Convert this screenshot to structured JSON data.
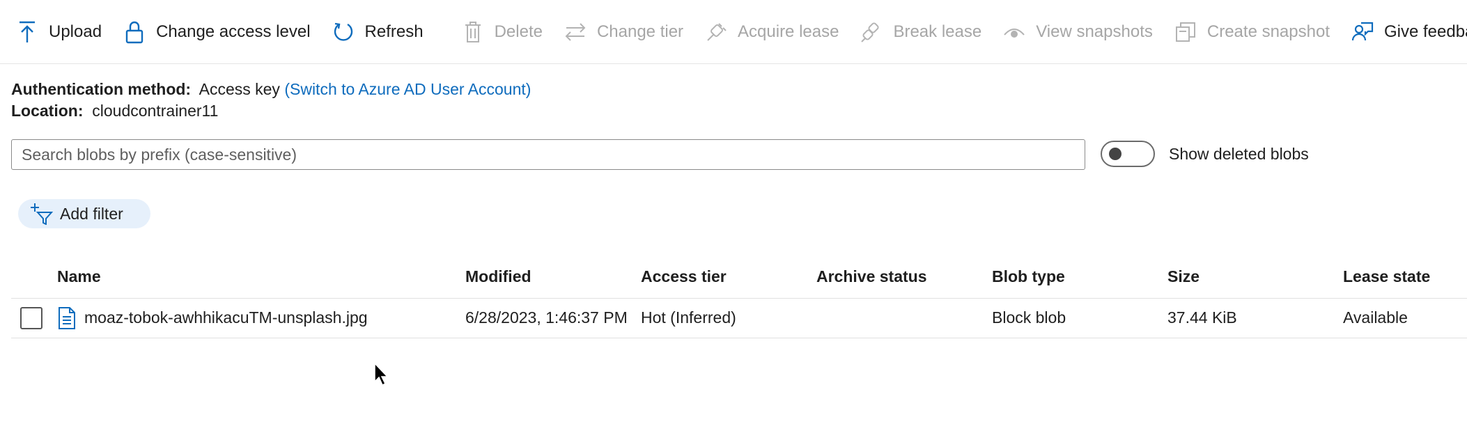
{
  "toolbar": {
    "upload": "Upload",
    "change_access_level": "Change access level",
    "refresh": "Refresh",
    "delete": "Delete",
    "change_tier": "Change tier",
    "acquire_lease": "Acquire lease",
    "break_lease": "Break lease",
    "view_snapshots": "View snapshots",
    "create_snapshot": "Create snapshot",
    "give_feedback": "Give feedback"
  },
  "info": {
    "auth_label": "Authentication method:",
    "auth_value": "Access key",
    "auth_link": "(Switch to Azure AD User Account)",
    "location_label": "Location:",
    "location_value": "cloudcontrainer11"
  },
  "search": {
    "placeholder": "Search blobs by prefix (case-sensitive)",
    "value": ""
  },
  "show_deleted": {
    "label": "Show deleted blobs",
    "on": false
  },
  "filter": {
    "label": "Add filter"
  },
  "table": {
    "columns": [
      "Name",
      "Modified",
      "Access tier",
      "Archive status",
      "Blob type",
      "Size",
      "Lease state"
    ],
    "rows": [
      {
        "name": "moaz-tobok-awhhikacuTM-unsplash.jpg",
        "modified": "6/28/2023, 1:46:37 PM",
        "access_tier": "Hot (Inferred)",
        "archive_status": "",
        "blob_type": "Block blob",
        "size": "37.44 KiB",
        "lease_state": "Available"
      }
    ]
  },
  "colors": {
    "accent": "#0f6cbd",
    "disabled": "#a6a6a6",
    "filter_bg": "#e6f0fb"
  }
}
